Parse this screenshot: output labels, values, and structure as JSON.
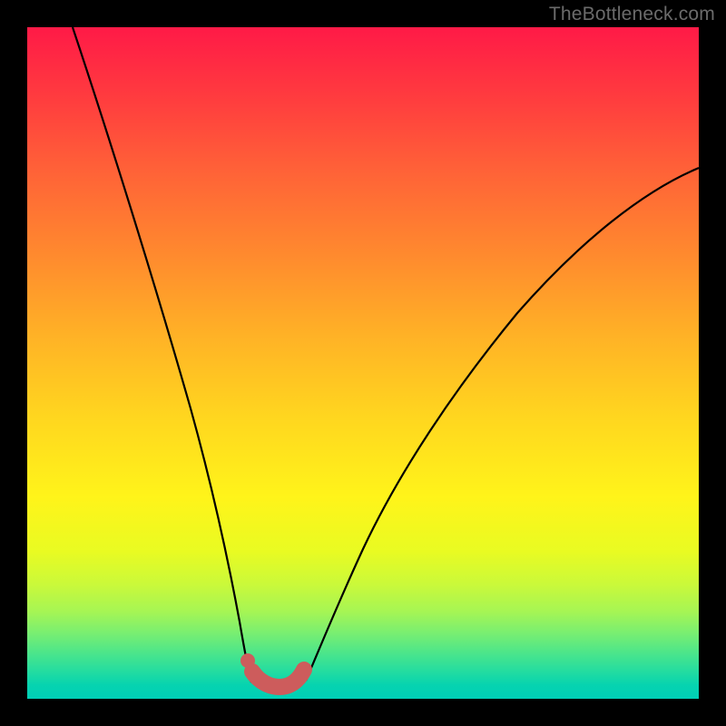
{
  "watermark": "TheBottleneck.com",
  "chart_data": {
    "type": "line",
    "title": "",
    "xlabel": "",
    "ylabel": "",
    "xlim": [
      0,
      100
    ],
    "ylim": [
      0,
      100
    ],
    "series": [
      {
        "name": "left-branch-curve",
        "x": [
          7,
          10,
          13,
          16,
          19,
          22,
          25,
          27,
          28.5,
          29.7,
          30.5,
          31.2,
          31.8,
          32.3
        ],
        "y": [
          100,
          86,
          73,
          61,
          50,
          40,
          30,
          21,
          15,
          10,
          7,
          5,
          3.5,
          2.5
        ]
      },
      {
        "name": "right-branch-curve",
        "x": [
          40.5,
          41.5,
          43,
          45,
          48,
          52,
          56,
          61,
          67,
          74,
          82,
          90,
          99.8
        ],
        "y": [
          2.8,
          4,
          6,
          9,
          14,
          21,
          28,
          35,
          43,
          52,
          61,
          70,
          79
        ]
      },
      {
        "name": "pink-dot",
        "x": [
          32.0
        ],
        "y": [
          5.7
        ]
      },
      {
        "name": "pink-valley-band",
        "x": [
          32.5,
          33.5,
          35.0,
          37.0,
          38.8,
          40.0,
          40.8
        ],
        "y": [
          4.5,
          2.8,
          1.9,
          1.8,
          2.2,
          3.2,
          4.8
        ]
      }
    ]
  },
  "colors": {
    "curve": "#000000",
    "pink": "#cd5c5c",
    "frame": "#000000"
  }
}
